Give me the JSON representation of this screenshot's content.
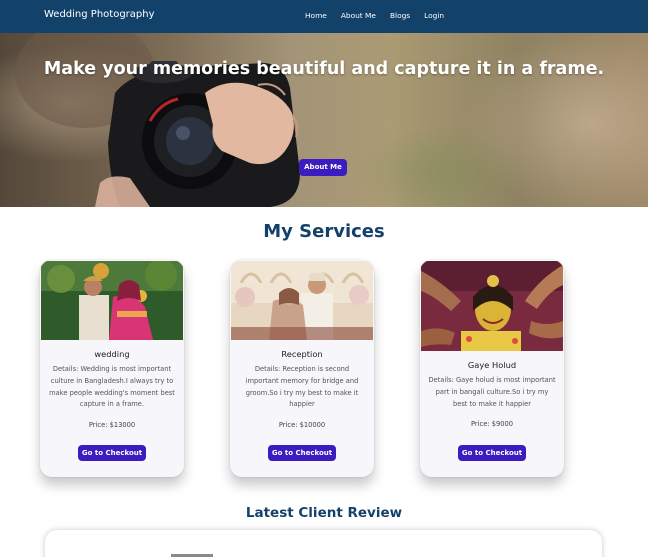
{
  "nav": {
    "brand": "Wedding Photography",
    "links": [
      "Home",
      "About Me",
      "Blogs",
      "Login"
    ]
  },
  "hero": {
    "title": "Make your memories beautiful and capture it in a frame.",
    "button": "About Me"
  },
  "services": {
    "title": "My Services",
    "cards": [
      {
        "title": "wedding",
        "details": "Details: Wedding is most important culture in Bangladesh.I always try to make people wedding's moment best capture in a frame.",
        "price": "Price: $13000",
        "button": "Go to Checkout"
      },
      {
        "title": "Reception",
        "details": "Details: Reception is second important memory for bridge and groom.So i try my best to make it happier",
        "price": "Price: $10000",
        "button": "Go to Checkout"
      },
      {
        "title": "Gaye Holud",
        "details": "Details: Gaye holud is most important part in bangali culture.So i try my best to make it happier",
        "price": "Price: $9000",
        "button": "Go to Checkout"
      }
    ]
  },
  "review": {
    "title": "Latest Client Review"
  },
  "colors": {
    "navbar": "#12416a",
    "accent_button": "#3b1cc0",
    "heading": "#14416a"
  }
}
